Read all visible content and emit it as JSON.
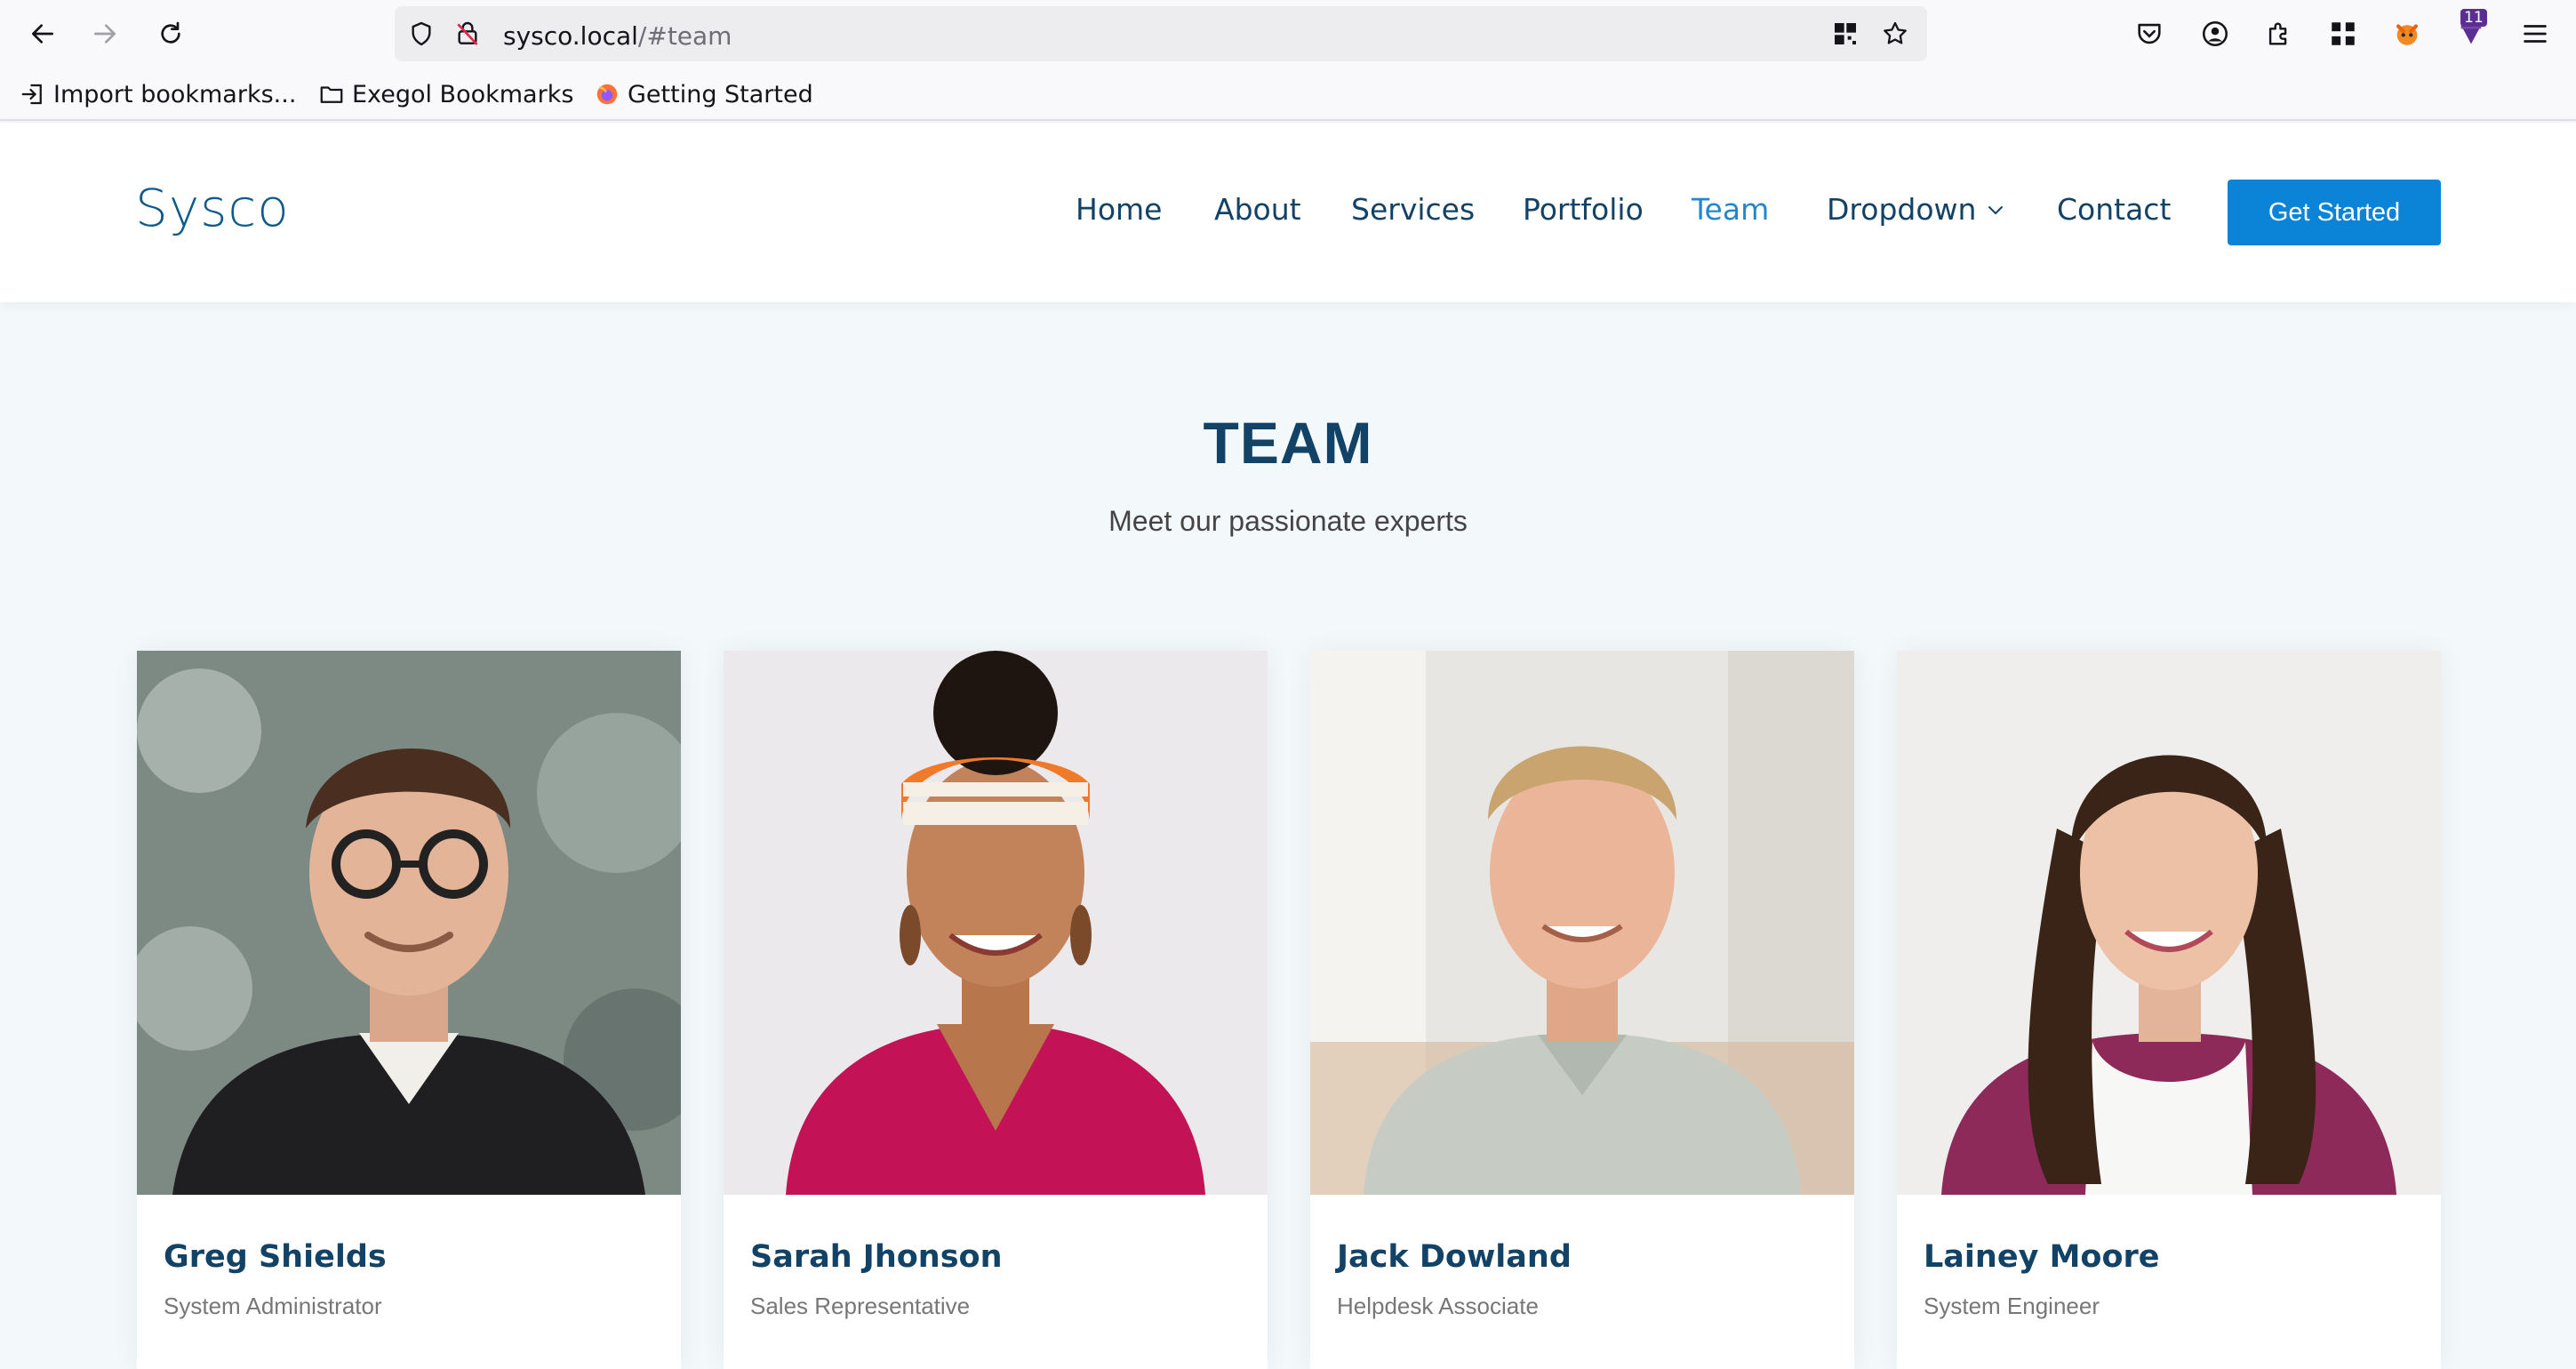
{
  "browser": {
    "url_host": "sysco.local",
    "url_path": "/#team",
    "extension_badge": "11",
    "bookmarks": [
      {
        "label": "Import bookmarks...",
        "icon": "import-icon"
      },
      {
        "label": "Exegol Bookmarks",
        "icon": "folder-icon"
      },
      {
        "label": "Getting Started",
        "icon": "firefox-icon"
      }
    ]
  },
  "site": {
    "logo": "Sysco",
    "nav": [
      "Home",
      "About",
      "Services",
      "Portfolio",
      "Team",
      "Dropdown",
      "Contact"
    ],
    "active_nav": "Team",
    "cta": "Get Started",
    "colors": {
      "primary": "#124265",
      "accent": "#2487ce",
      "button": "#0b84d8"
    }
  },
  "team": {
    "title": "TEAM",
    "subtitle": "Meet our passionate experts",
    "members": [
      {
        "name": "Greg Shields",
        "role": "System Administrator"
      },
      {
        "name": "Sarah Jhonson",
        "role": "Sales Representative"
      },
      {
        "name": "Jack Dowland",
        "role": "Helpdesk Associate"
      },
      {
        "name": "Lainey Moore",
        "role": "System Engineer"
      }
    ]
  }
}
